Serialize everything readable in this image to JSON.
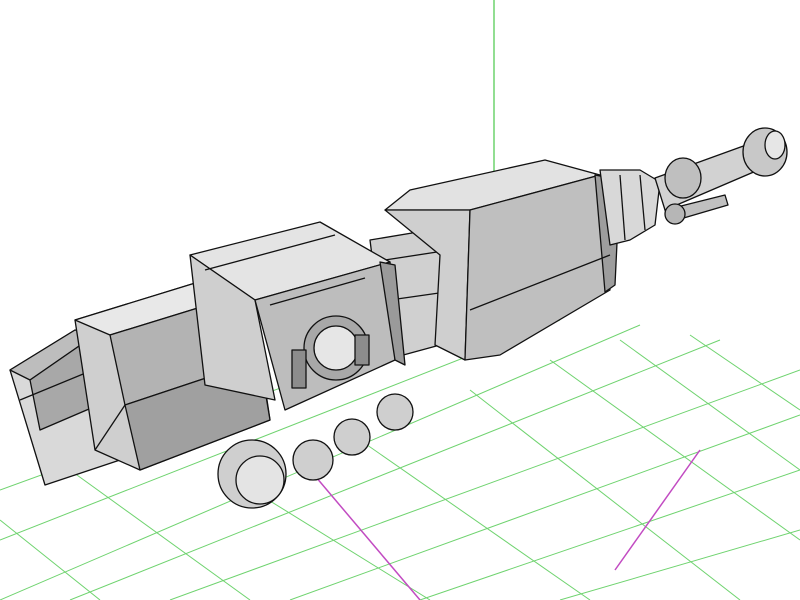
{
  "scene": {
    "background_color": "#ffffff",
    "grid_color": "#6fd36f",
    "axis_x_color": "#c24bc2",
    "axis_y_color": "#6fd36f",
    "mesh_fill_light": "#e2e2e2",
    "mesh_fill_mid": "#c8c8c8",
    "mesh_fill_dark": "#9c9c9c",
    "mesh_edge_color": "#111111",
    "object": "wireframe-gun-turret-model"
  }
}
